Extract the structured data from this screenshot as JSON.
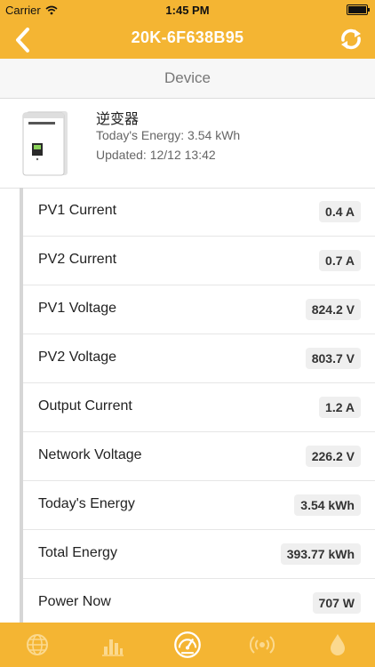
{
  "status_bar": {
    "carrier": "Carrier",
    "time": "1:45 PM"
  },
  "nav": {
    "title": "20K-6F638B95"
  },
  "section": {
    "title": "Device"
  },
  "device": {
    "name": "逆变器",
    "energy": "Today's Energy: 3.54 kWh",
    "updated": "Updated: 12/12 13:42",
    "image_icon": "inverter-device-icon"
  },
  "metrics": [
    {
      "label": "PV1 Current",
      "value": "0.4 A"
    },
    {
      "label": "PV2 Current",
      "value": "0.7 A"
    },
    {
      "label": "PV1 Voltage",
      "value": "824.2 V"
    },
    {
      "label": "PV2 Voltage",
      "value": "803.7 V"
    },
    {
      "label": "Output Current",
      "value": "1.2 A"
    },
    {
      "label": "Network Voltage",
      "value": "226.2 V"
    },
    {
      "label": "Today's Energy",
      "value": "3.54 kWh"
    },
    {
      "label": "Total Energy",
      "value": "393.77 kWh"
    },
    {
      "label": "Power Now",
      "value": "707 W"
    }
  ],
  "tabs": [
    {
      "icon": "globe-icon"
    },
    {
      "icon": "bar-chart-icon"
    },
    {
      "icon": "gauge-icon",
      "active": true
    },
    {
      "icon": "broadcast-icon"
    },
    {
      "icon": "drop-icon"
    }
  ],
  "colors": {
    "accent": "#f4b533",
    "tab_inactive": "#fbd98f",
    "tab_active": "#ffffff"
  }
}
